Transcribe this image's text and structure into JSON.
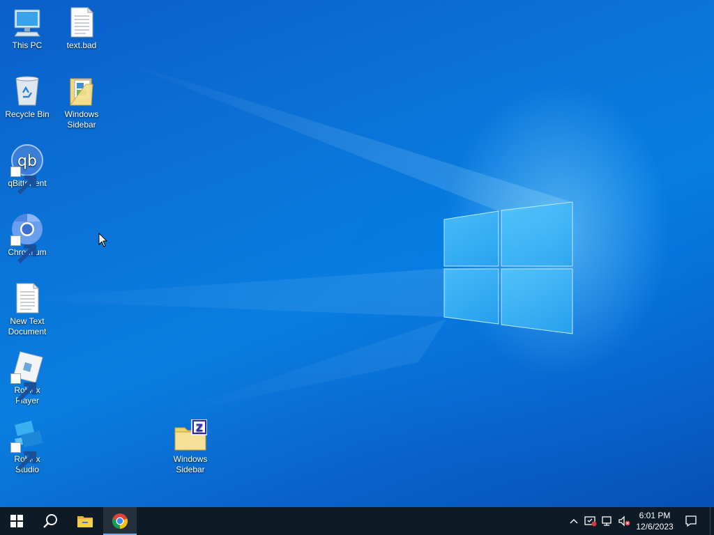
{
  "desktop": {
    "icons": [
      {
        "label": "This PC",
        "icon": "this-pc-icon"
      },
      {
        "label": "text.bad",
        "icon": "text-document-icon"
      },
      {
        "label": "Recycle Bin",
        "icon": "recycle-bin-icon"
      },
      {
        "label": "Windows Sidebar",
        "icon": "folder-icon"
      },
      {
        "label": "qBittorrent",
        "icon": "qbittorrent-icon"
      },
      {
        "label": "Chromium",
        "icon": "chromium-icon"
      },
      {
        "label": "New Text Document",
        "icon": "text-document-icon"
      },
      {
        "label": "Roblox Player",
        "icon": "roblox-player-icon"
      },
      {
        "label": "Roblox Studio",
        "icon": "roblox-studio-icon"
      },
      {
        "label": "Windows Sidebar",
        "icon": "winzip-folder-icon"
      }
    ]
  },
  "taskbar": {
    "start": "windows-logo-icon",
    "search": "search-icon",
    "pinned": [
      "file-explorer-icon",
      "chrome-icon"
    ],
    "tray": [
      "chevron-up-icon",
      "security-icon",
      "network-icon",
      "volume-muted-icon"
    ],
    "clock": {
      "time": "6:01 PM",
      "date": "12/6/2023"
    },
    "notifications": "action-center-icon"
  },
  "colors": {
    "wallpaper": "#0a74d8",
    "taskbar": "#0e1a26",
    "accent": "#7aaee8"
  }
}
